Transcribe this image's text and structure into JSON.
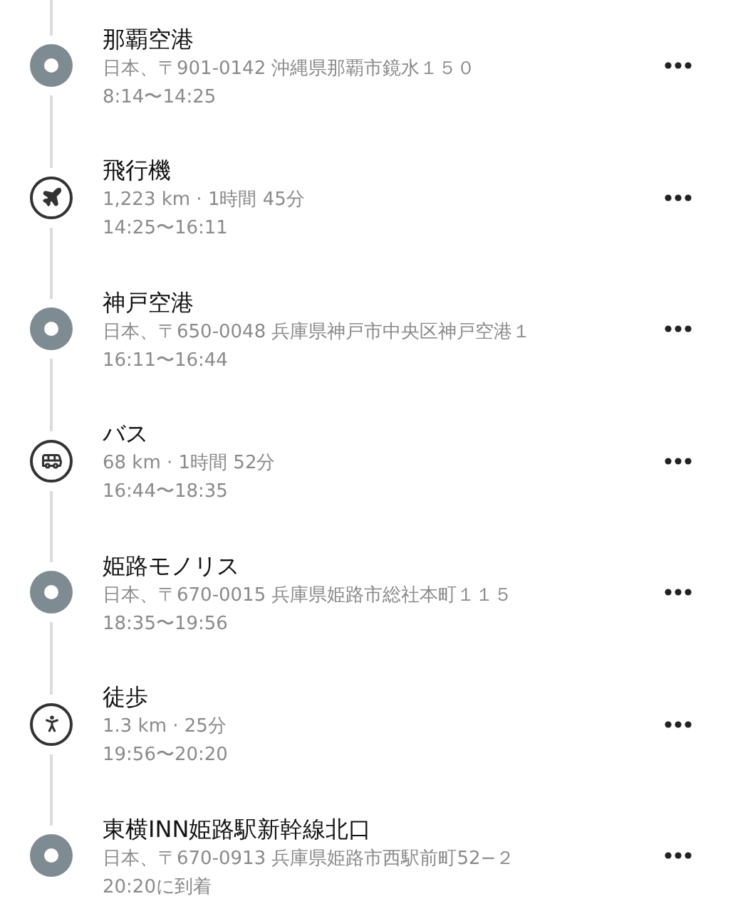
{
  "steps": [
    {
      "kind": "place",
      "title": "那覇空港",
      "detail": "日本、〒901-0142 沖縄県那覇市鏡水１５０",
      "time": "8:14〜14:25"
    },
    {
      "kind": "flight",
      "title": "飛行機",
      "detail": "1,223 km · 1時間 45分",
      "time": "14:25〜16:11"
    },
    {
      "kind": "place",
      "title": "神戸空港",
      "detail": "日本、〒650-0048 兵庫県神戸市中央区神戸空港１",
      "time": "16:11〜16:44"
    },
    {
      "kind": "bus",
      "title": "バス",
      "detail": "68 km · 1時間 52分",
      "time": "16:44〜18:35"
    },
    {
      "kind": "place",
      "title": "姫路モノリス",
      "detail": "日本、〒670-0015 兵庫県姫路市総社本町１１５",
      "time": "18:35〜19:56"
    },
    {
      "kind": "walk",
      "title": "徒歩",
      "detail": "1.3 km · 25分",
      "time": "19:56〜20:20"
    },
    {
      "kind": "place",
      "title": "東横INN姫路駅新幹線北口",
      "detail": "日本、〒670-0913 兵庫県姫路市西駅前町52−２",
      "time": "20:20に到着"
    }
  ]
}
